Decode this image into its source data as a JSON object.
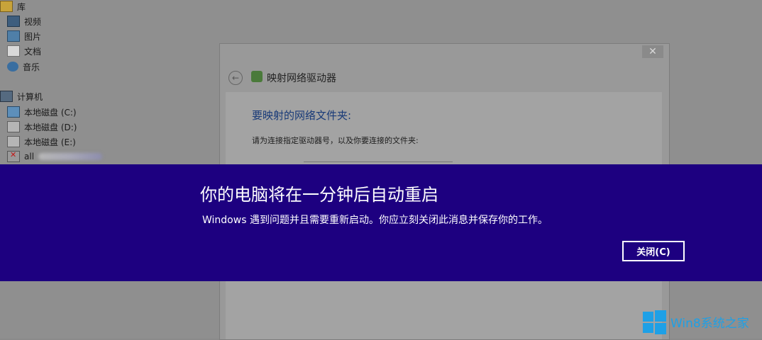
{
  "explorer": {
    "nav_items": [
      {
        "label": "库",
        "icon": "library-icon"
      },
      {
        "label": "视频",
        "icon": "video-icon"
      },
      {
        "label": "图片",
        "icon": "pictures-icon"
      },
      {
        "label": "文档",
        "icon": "documents-icon"
      },
      {
        "label": "音乐",
        "icon": "music-icon"
      },
      {
        "label": "计算机",
        "icon": "computer-icon"
      },
      {
        "label": "本地磁盘 (C:)",
        "icon": "system-drive-icon"
      },
      {
        "label": "本地磁盘 (D:)",
        "icon": "drive-icon"
      },
      {
        "label": "本地磁盘 (E:)",
        "icon": "drive-icon"
      },
      {
        "label": "all",
        "icon": "network-drive-disconnected-icon"
      }
    ]
  },
  "dialog": {
    "title": "映射网络驱动器",
    "heading": "要映射的网络文件夹:",
    "description": "请为连接指定驱动器号，以及你要连接的文件夹:",
    "close_glyph": "✕",
    "back_glyph": "←"
  },
  "banner": {
    "title": "你的电脑将在一分钟后自动重启",
    "message": "Windows 遇到问题并且需要重新启动。你应立刻关闭此消息并保存你的工作。",
    "close_label": "关闭(C)",
    "background_color": "#1d0080"
  },
  "watermark": {
    "text": "Win8系统之家",
    "color": "#1ea0e6"
  }
}
